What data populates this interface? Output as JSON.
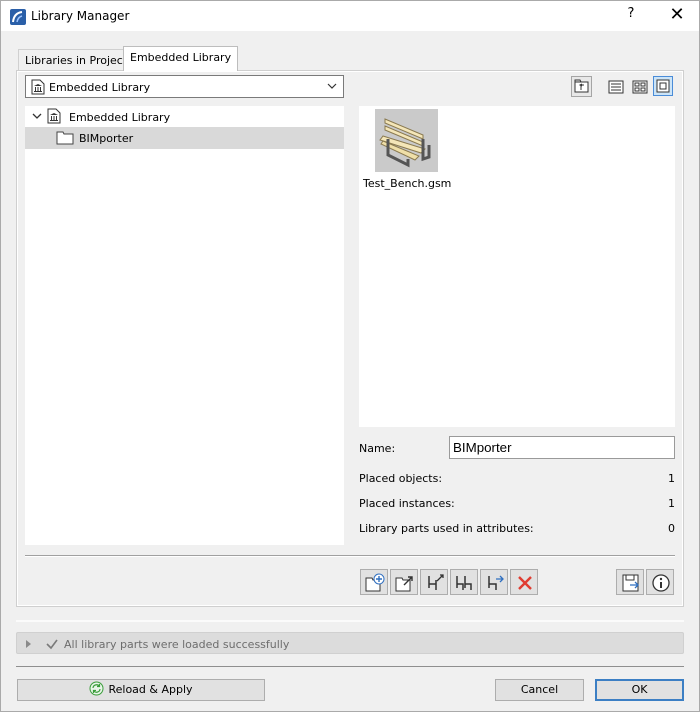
{
  "window": {
    "title": "Library Manager",
    "help_label": "?",
    "close_label": "✕"
  },
  "tabs": [
    {
      "label": "Libraries in Project"
    },
    {
      "label": "Embedded Library"
    }
  ],
  "library_select": {
    "value": "Embedded Library"
  },
  "tree": [
    {
      "label": "Embedded Library",
      "expanded": true
    },
    {
      "label": "BIMporter",
      "selected": true
    }
  ],
  "preview": {
    "items": [
      {
        "label": "Test_Bench.gsm",
        "icon": "bench-thumbnail"
      }
    ]
  },
  "properties": {
    "name_label": "Name:",
    "name_value": "BIMporter",
    "placed_objects_label": "Placed objects:",
    "placed_objects_value": "1",
    "placed_instances_label": "Placed instances:",
    "placed_instances_value": "1",
    "attr_parts_label": "Library parts used in attributes:",
    "attr_parts_value": "0"
  },
  "status": {
    "text": "All library parts were loaded successfully"
  },
  "buttons": {
    "reload": "Reload & Apply",
    "cancel": "Cancel",
    "ok": "OK"
  },
  "colors": {
    "accent": "#3c7fc4",
    "delete_red": "#e03c31",
    "reload_green": "#3a9d3a"
  }
}
